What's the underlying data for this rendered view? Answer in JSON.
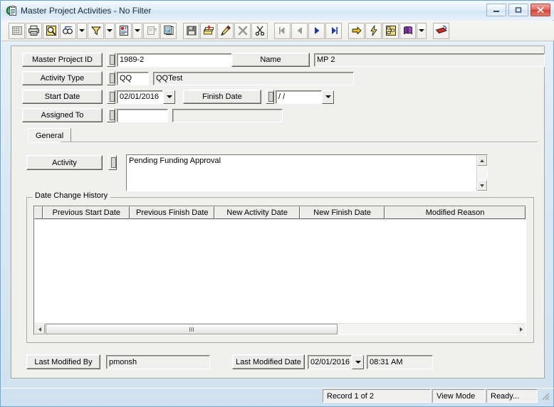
{
  "window": {
    "title": "Master Project Activities - No Filter",
    "icon": "clipboard-icon",
    "minimize_label": "",
    "maximize_label": "",
    "close_label": "✕"
  },
  "toolbar": {
    "buttons": [
      {
        "name": "grid-view-icon",
        "label": ""
      },
      {
        "name": "print-icon",
        "label": ""
      },
      {
        "name": "print-preview-icon",
        "label": ""
      },
      {
        "name": "find-icon",
        "label": ""
      },
      {
        "name": "find-dropdown-arrow",
        "label": ""
      },
      {
        "name": "filter-icon",
        "label": ""
      },
      {
        "name": "filter-dropdown-arrow",
        "label": ""
      },
      {
        "name": "report-icon",
        "label": ""
      },
      {
        "name": "report-dropdown-arrow",
        "label": ""
      },
      {
        "name": "properties-icon",
        "label": ""
      },
      {
        "name": "copy-record-icon",
        "label": ""
      },
      {
        "name": "save-icon",
        "label": ""
      },
      {
        "name": "new-record-icon",
        "label": ""
      },
      {
        "name": "edit-icon",
        "label": ""
      },
      {
        "name": "delete-icon",
        "label": ""
      },
      {
        "name": "cut-icon",
        "label": ""
      },
      {
        "name": "first-record-icon",
        "label": ""
      },
      {
        "name": "previous-record-icon",
        "label": ""
      },
      {
        "name": "next-record-icon",
        "label": ""
      },
      {
        "name": "last-record-icon",
        "label": ""
      },
      {
        "name": "goto-icon",
        "label": ""
      },
      {
        "name": "quick-action-icon",
        "label": ""
      },
      {
        "name": "workflow-icon",
        "label": ""
      },
      {
        "name": "help-icon",
        "label": ""
      },
      {
        "name": "help-dropdown-arrow",
        "label": ""
      },
      {
        "name": "exit-icon",
        "label": ""
      }
    ]
  },
  "form": {
    "master_project_id": {
      "label": "Master Project ID",
      "value": "1989-2"
    },
    "name": {
      "label": "Name",
      "value": "MP 2"
    },
    "activity_type": {
      "label": "Activity Type",
      "code": "QQ",
      "description": "QQTest"
    },
    "start_date": {
      "label": "Start Date",
      "value": "02/01/2016"
    },
    "finish_date": {
      "label": "Finish Date",
      "value": "  /  /"
    },
    "assigned_to": {
      "label": "Assigned To",
      "value": "",
      "description": ""
    }
  },
  "tabs": [
    {
      "label": "General",
      "selected": true
    }
  ],
  "activity": {
    "label": "Activity",
    "value": "Pending Funding Approval"
  },
  "date_change_history": {
    "group_label": "Date Change History",
    "columns": [
      "Previous Start Date",
      "Previous Finish Date",
      "New Activity Date",
      "New Finish Date",
      "Modified Reason"
    ],
    "rows": []
  },
  "footer": {
    "last_modified_by": {
      "label": "Last Modified By",
      "value": "pmonsh"
    },
    "last_modified_date": {
      "label": "Last Modified Date",
      "value": "02/01/2016"
    },
    "last_modified_time": {
      "value": "08:31 AM"
    }
  },
  "status": {
    "record": "Record 1 of 2",
    "mode": "View Mode",
    "state": "Ready..."
  },
  "colors": {
    "window_frame": "#6fa8d0",
    "panel": "#f0f0ee",
    "field_bg": "#ffffff",
    "close_button": "#cf4237"
  }
}
